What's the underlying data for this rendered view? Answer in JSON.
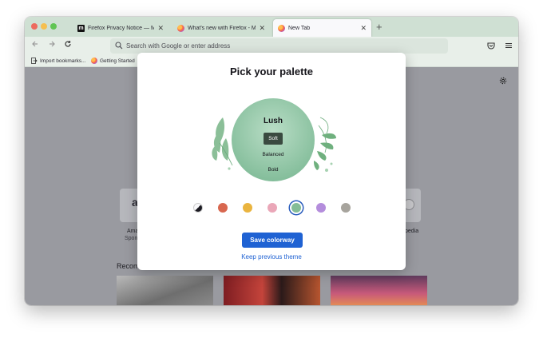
{
  "browser": {
    "tabs": [
      {
        "title": "Firefox Privacy Notice — Mozilla",
        "favicon": "mozilla-m-icon"
      },
      {
        "title": "What's new with Firefox - More",
        "favicon": "firefox-icon"
      },
      {
        "title": "New Tab",
        "favicon": "firefox-icon",
        "active": true
      }
    ],
    "new_tab_symbol": "+",
    "close_symbol": "✕",
    "url_placeholder": "Search with Google or enter address",
    "bookmarks": [
      {
        "label": "Import bookmarks...",
        "icon": "import-icon"
      },
      {
        "label": "Getting Started",
        "icon": "firefox-icon"
      }
    ]
  },
  "newtab": {
    "shortcuts": [
      {
        "label": "Ama",
        "sublabel": "Spon",
        "logo": "a"
      },
      {
        "label": "pedia",
        "logo": "wikipedia-icon"
      }
    ],
    "recent_label": "Recom"
  },
  "modal": {
    "title": "Pick your palette",
    "colorway_name": "Lush",
    "options": [
      "Soft",
      "Balanced",
      "Bold"
    ],
    "selected_option": "Soft",
    "swatches": [
      {
        "name": "default",
        "color": "#1c1b22",
        "color2": "#f9f9fb"
      },
      {
        "name": "red",
        "color": "#d8674f"
      },
      {
        "name": "yellow",
        "color": "#eab43f"
      },
      {
        "name": "pink",
        "color": "#eaa7b8"
      },
      {
        "name": "green",
        "color": "#84bd96",
        "selected": true
      },
      {
        "name": "purple",
        "color": "#b48ddc"
      },
      {
        "name": "gray",
        "color": "#a7a49d"
      }
    ],
    "save_label": "Save colorway",
    "keep_label": "Keep previous theme"
  },
  "colors": {
    "accent": "#1f62d3",
    "titlebar": "#cfe0d3"
  }
}
